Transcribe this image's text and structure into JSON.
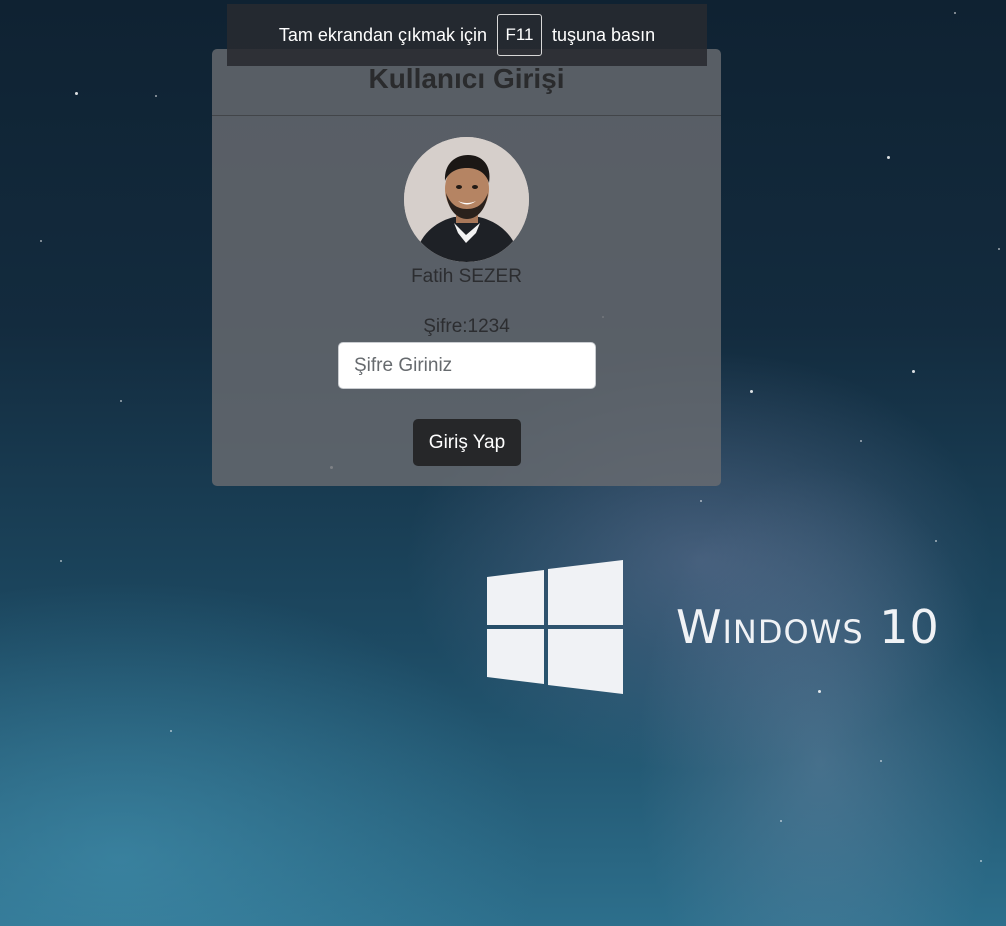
{
  "fullscreen_hint": {
    "before": "Tam ekrandan çıkmak için",
    "key": "F11",
    "after": "tuşuna basın"
  },
  "login": {
    "title": "Kullanıcı Girişi",
    "user_name": "Fatih SEZER",
    "password_hint": "Şifre:1234",
    "password_placeholder": "Şifre Giriniz",
    "password_value": "",
    "submit_label": "Giriş Yap"
  },
  "wallpaper": {
    "brand_text": "Windows 10",
    "logo_icon": "windows-logo-icon",
    "accent_color": "#f0f2f5"
  },
  "colors": {
    "card_background": "#6a6b70",
    "button_background": "#262729"
  }
}
